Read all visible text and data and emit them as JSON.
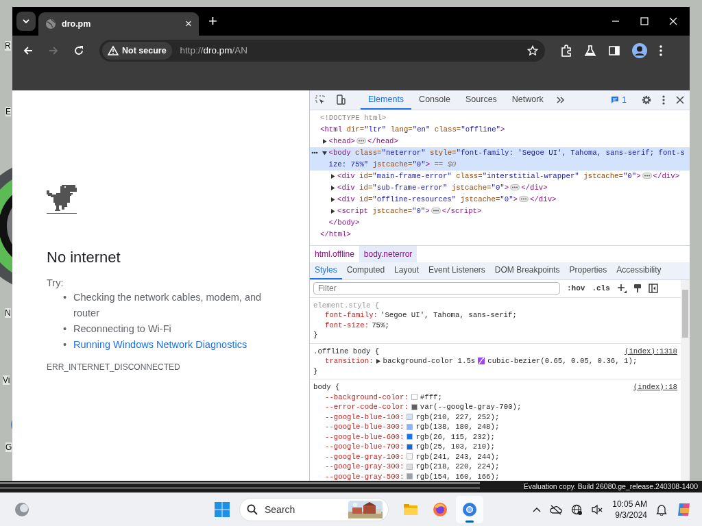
{
  "desktop": {
    "icon_labels": [
      "R",
      "E",
      "N",
      "Vi",
      "G"
    ],
    "watermark": "Evaluation copy. Build 26080.ge_release.240308-1400"
  },
  "browser": {
    "tab": {
      "title": "dro.pm",
      "close": "×"
    },
    "new_tab": "+",
    "security": "Not secure",
    "url_scheme": "http://",
    "url_host": "dro.pm",
    "url_path": "/AN",
    "forward_disabled": true
  },
  "page": {
    "title": "No internet",
    "try": "Try:",
    "suggestions": [
      {
        "marker": "•",
        "text": "Checking the network cables, modem, and router",
        "kind": "plain"
      },
      {
        "marker": "•",
        "text": "Reconnecting to Wi-Fi",
        "kind": "plain"
      },
      {
        "marker": "•",
        "text": "Running Windows Network Diagnostics",
        "kind": "link"
      }
    ],
    "error_code": "ERR_INTERNET_DISCONNECTED"
  },
  "devtools": {
    "tabs": [
      {
        "label": "Elements",
        "selected": true
      },
      {
        "label": "Console",
        "selected": false
      },
      {
        "label": "Sources",
        "selected": false
      },
      {
        "label": "Network",
        "selected": false
      }
    ],
    "issues_count": "1",
    "dom": [
      {
        "kind": "doctype",
        "text": "<!DOCTYPE html>",
        "selected": false
      },
      {
        "text": "<html dir=\"ltr\" lang=\"en\" class=\"offline\">",
        "end": "</html>",
        "selected": false,
        "children": [
          {
            "text": "<head>",
            "close": "</head>",
            "expanded": false,
            "selected": false
          },
          {
            "text": "<body class=\"neterror\" style=\"font-family: 'Segoe UI', Tahoma, sans-serif; font-size: 75%\" jstcache=\"0\">",
            "marker": "== $0",
            "expanded": true,
            "selected": true,
            "end": "</body>",
            "children": [
              {
                "text": "<div id=\"main-frame-error\" class=\"interstitial-wrapper\" jstcache=\"0\">",
                "close": "</div>",
                "expanded": false,
                "selected": false
              },
              {
                "text": "<div id=\"sub-frame-error\" jstcache=\"0\">",
                "close": "</div>",
                "expanded": false,
                "selected": false
              },
              {
                "text": "<div id=\"offline-resources\" jstcache=\"0\">",
                "close": "</div>",
                "expanded": false,
                "selected": false
              },
              {
                "text": "<script jstcache=\"0\">",
                "close": "</script>",
                "expanded": false,
                "selected": false
              }
            ]
          }
        ]
      }
    ],
    "breadcrumbs": [
      {
        "label": "html.offline",
        "selected": false
      },
      {
        "label": "body.neterror",
        "selected": true
      }
    ],
    "style_tabs": [
      {
        "label": "Styles",
        "selected": true
      },
      {
        "label": "Computed",
        "selected": false
      },
      {
        "label": "Layout",
        "selected": false
      },
      {
        "label": "Event Listeners",
        "selected": false
      },
      {
        "label": "DOM Breakpoints",
        "selected": false
      },
      {
        "label": "Properties",
        "selected": false
      },
      {
        "label": "Accessibility",
        "selected": false
      }
    ],
    "filter": {
      "placeholder": "Filter"
    },
    "hov": ":hov",
    "cls": ".cls",
    "rules": [
      {
        "kind": "inline",
        "selector": "element.style {",
        "close": "}",
        "props": [
          {
            "name": "font-family:",
            "value": "'Segoe UI', Tahoma, sans-serif;"
          },
          {
            "name": "font-size:",
            "value": "75%;"
          }
        ]
      },
      {
        "kind": "sheet",
        "selector": ".offline body {",
        "source": "(index):1318",
        "close": "}",
        "props": [
          {
            "name": "transition:",
            "value": "background-color 1.5s",
            "expandable": true,
            "easing": "cubic-bezier(0.65, 0.05, 0.36, 1);"
          }
        ]
      },
      {
        "kind": "sheet",
        "selector": "body {",
        "source": "(index):18",
        "props": [
          {
            "name": "--background-color:",
            "color": "#ffffff",
            "value": "#fff;"
          },
          {
            "name": "--error-code-color:",
            "color": "#5f6368",
            "value": "var(--google-gray-700);"
          },
          {
            "name": "--google-blue-100:",
            "color": "#d2e3fc",
            "value": "rgb(210, 227, 252);"
          },
          {
            "name": "--google-blue-300:",
            "color": "#8ab4f8",
            "value": "rgb(138, 180, 248);"
          },
          {
            "name": "--google-blue-600:",
            "color": "#1a73e8",
            "value": "rgb(26, 115, 232);"
          },
          {
            "name": "--google-blue-700:",
            "color": "#1967d2",
            "value": "rgb(25, 103, 210);"
          },
          {
            "name": "--google-gray-100:",
            "color": "#f1f3f4",
            "value": "rgb(241, 243, 244);"
          },
          {
            "name": "--google-gray-300:",
            "color": "#dadce0",
            "value": "rgb(218, 220, 224);"
          },
          {
            "name": "--google-gray-500:",
            "color": "#9aa0a6",
            "value": "rgb(154, 160, 166);"
          }
        ]
      }
    ]
  },
  "taskbar": {
    "search": "Search",
    "time": "10:05 AM",
    "date": "9/3/2024",
    "apps": [
      {
        "kind": "files",
        "selected": false
      },
      {
        "kind": "firefox",
        "selected": false
      },
      {
        "kind": "browser",
        "selected": true
      }
    ]
  }
}
